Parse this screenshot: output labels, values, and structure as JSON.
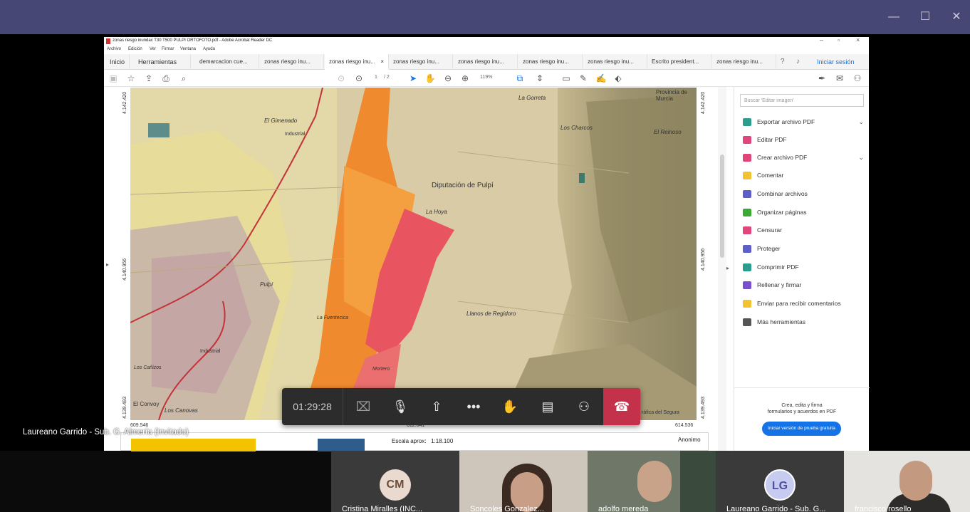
{
  "window": {
    "minimize": "—",
    "maximize": "☐",
    "close": "✕"
  },
  "acrobat": {
    "title": "zonas riesgo inundac T30 T500 PULPI ORTOFOTO.pdf - Adobe Acrobat Reader DC",
    "menu": [
      "Archivo",
      "Edición",
      "Ver",
      "Firmar",
      "Ventana",
      "Ayuda"
    ],
    "tabs": [
      {
        "label": "Inicio"
      },
      {
        "label": "Herramientas"
      },
      {
        "label": "demarcacion cue..."
      },
      {
        "label": "zonas riesgo inu..."
      },
      {
        "label": "zonas riesgo inu...",
        "active": true,
        "close": "×"
      },
      {
        "label": "zonas riesgo inu..."
      },
      {
        "label": "zonas riesgo inu..."
      },
      {
        "label": "zonas riesgo inu..."
      },
      {
        "label": "zonas riesgo inu..."
      },
      {
        "label": "Escrito president..."
      },
      {
        "label": "zonas riesgo inu..."
      }
    ],
    "signin": "Iniciar sesión",
    "page_current": "1",
    "page_total": "/ 2",
    "zoom": "119%",
    "search_placeholder": "Buscar 'Editar imagen'",
    "tools": [
      {
        "label": "Exportar archivo PDF",
        "color": "#2a9d8f",
        "expand": true
      },
      {
        "label": "Editar PDF",
        "color": "#e0457b"
      },
      {
        "label": "Crear archivo PDF",
        "color": "#e0457b",
        "expand": true
      },
      {
        "label": "Comentar",
        "color": "#f2c230"
      },
      {
        "label": "Combinar archivos",
        "color": "#5b5fc7"
      },
      {
        "label": "Organizar páginas",
        "color": "#3aaa35"
      },
      {
        "label": "Censurar",
        "color": "#e0457b"
      },
      {
        "label": "Proteger",
        "color": "#5b5fc7"
      },
      {
        "label": "Comprimir PDF",
        "color": "#2a9d8f"
      },
      {
        "label": "Rellenar y firmar",
        "color": "#7a4fd0"
      },
      {
        "label": "Enviar para recibir comentarios",
        "color": "#f2c230"
      },
      {
        "label": "Más herramientas",
        "color": "#555555"
      }
    ],
    "promo_line1": "Crea, edita y firma",
    "promo_line2": "formularios y acuerdos en PDF",
    "trial_button": "Iniciar versión de prueba gratuita"
  },
  "map": {
    "labels": [
      "Provincia de Murcia",
      "La Gorreta",
      "El Gimenado",
      "Industrial",
      "Los Charcos",
      "El Reinoso",
      "Diputación de Pulpí",
      "La Hoya",
      "Pulpí",
      "Llanos de Regidoro",
      "Industrial",
      "Los Cañizos",
      "La Fuentecica",
      "Mortero",
      "El Convoy",
      "Los Canovas"
    ],
    "coords": {
      "y_top_left": "4.142.420",
      "y_mid_left": "4.140.956",
      "y_bot_left": "4.139.493",
      "y_top_right": "4.142.420",
      "y_mid_right": "4.140.956",
      "y_bot_right": "4.139.493",
      "x_left": "609.546",
      "x_mid": "612.041",
      "x_right": "614.536"
    },
    "scale": "Escala aprox:   1:18.100",
    "author": "Anonimo",
    "credit": "ráfica del Segura"
  },
  "meeting": {
    "timer": "01:29:28",
    "speaker": "Laureano Garrido - Sub. G. Almería (Invitado)",
    "participants": [
      {
        "initials": "CM",
        "name": "Cristina Miralles (INC..."
      },
      {
        "initials": "",
        "name": "Soncoles Gonzalez..."
      },
      {
        "initials": "",
        "name": "adolfo mereda"
      },
      {
        "initials": "LG",
        "name": "Laureano Garrido - Sub. G..."
      },
      {
        "initials": "",
        "name": "francisco rosello"
      }
    ]
  }
}
